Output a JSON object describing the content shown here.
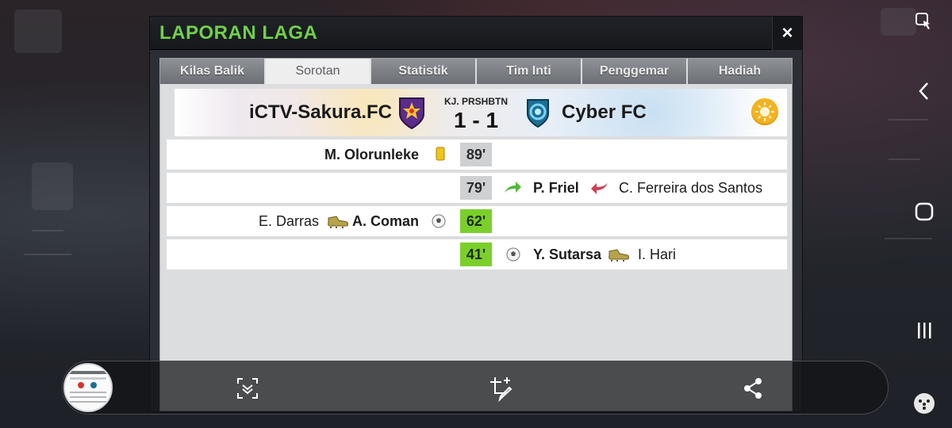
{
  "dialog": {
    "title": "LAPORAN LAGA",
    "close_label": "×"
  },
  "tabs": [
    {
      "label": "Kilas Balik",
      "active": false
    },
    {
      "label": "Sorotan",
      "active": true
    },
    {
      "label": "Statistik",
      "active": false
    },
    {
      "label": "Tim Inti",
      "active": false
    },
    {
      "label": "Penggemar",
      "active": false
    },
    {
      "label": "Hadiah",
      "active": false
    }
  ],
  "match": {
    "home_team": "iCTV-Sakura.FC",
    "competition": "KJ. PRSHBTN",
    "score": "1 - 1",
    "away_team": "Cyber FC",
    "weather_icon": "sun-icon"
  },
  "events": [
    {
      "minute": "89'",
      "type": "yellow-card",
      "side": "home",
      "player": "M. Olorunleke"
    },
    {
      "minute": "79'",
      "type": "substitution",
      "side": "away",
      "player_in": "P. Friel",
      "player_out": "C. Ferreira dos Santos"
    },
    {
      "minute": "62'",
      "type": "goal",
      "side": "home",
      "scorer": "A. Coman",
      "assist": "E. Darras"
    },
    {
      "minute": "41'",
      "type": "goal",
      "side": "away",
      "scorer": "Y. Sutarsa",
      "assist": "I. Hari"
    }
  ],
  "colors": {
    "title_green": "#6fd14a",
    "goal_minute": "#7bcf2b",
    "yellow_card": "#f2c417",
    "weather_sun": "#f3b21f"
  },
  "toolbar": {
    "icons": [
      "scroll-capture-icon",
      "crop-edit-icon",
      "share-icon"
    ]
  },
  "system_nav": {
    "icons": [
      "screen-capture-icon",
      "back-icon",
      "home-icon",
      "recents-icon",
      "game-tools-icon"
    ]
  }
}
